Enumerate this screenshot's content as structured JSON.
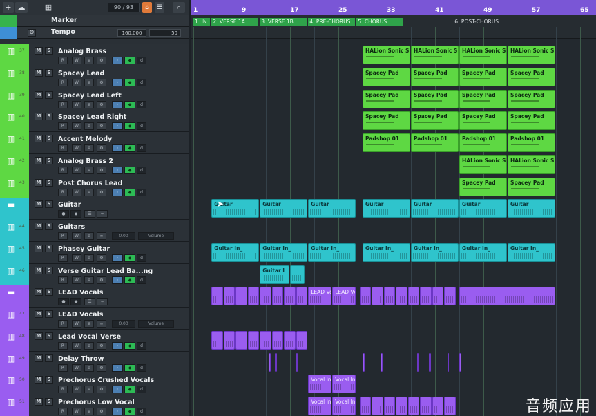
{
  "toolbar": {
    "add_label": "+",
    "counter": "90 / 93"
  },
  "ruler_rows": {
    "marker_label": "Marker",
    "tempo_label": "Tempo",
    "tempo_value": "160.000",
    "tempo_value2": "50"
  },
  "ruler": {
    "bars": [
      "1",
      "9",
      "17",
      "25",
      "33",
      "41",
      "49",
      "57",
      "65"
    ]
  },
  "markers": [
    {
      "label": "1: IN"
    },
    {
      "label": "2: VERSE 1A"
    },
    {
      "label": "3: VERSE 1B"
    },
    {
      "label": "4: PRE-CHORUS"
    },
    {
      "label": "5: CHORUS"
    },
    {
      "label": "6: POST-CHORUS"
    }
  ],
  "tracks": [
    {
      "num": "37",
      "name": "Analog Brass",
      "color": "#5ed843"
    },
    {
      "num": "38",
      "name": "Spacey Lead",
      "color": "#5ed843"
    },
    {
      "num": "39",
      "name": "Spacey Lead Left",
      "color": "#5ed843"
    },
    {
      "num": "40",
      "name": "Spacey Lead Right",
      "color": "#5ed843"
    },
    {
      "num": "41",
      "name": "Accent Melody",
      "color": "#5ed843"
    },
    {
      "num": "42",
      "name": "Analog Brass 2",
      "color": "#5ed843"
    },
    {
      "num": "43",
      "name": "Post Chorus Lead",
      "color": "#5ed843"
    },
    {
      "num": "",
      "name": "Guitar",
      "color": "#2fc4cc"
    },
    {
      "num": "44",
      "name": "Guitars",
      "color": "#2fc4cc",
      "vol": "0.00",
      "vol_label": "Volume"
    },
    {
      "num": "45",
      "name": "Phasey Guitar",
      "color": "#2fc4cc"
    },
    {
      "num": "46",
      "name": "Verse Guitar Lead Ba...ng",
      "color": "#2fc4cc"
    },
    {
      "num": "",
      "name": "LEAD Vocals",
      "color": "#9a5df0"
    },
    {
      "num": "47",
      "name": "LEAD Vocals",
      "color": "#9a5df0",
      "vol": "0.00",
      "vol_label": "Volume"
    },
    {
      "num": "48",
      "name": "Lead Vocal Verse",
      "color": "#9a5df0"
    },
    {
      "num": "49",
      "name": "Delay Throw",
      "color": "#9a5df0"
    },
    {
      "num": "50",
      "name": "Prechorus Crushed Vocals",
      "color": "#9a5df0"
    },
    {
      "num": "51",
      "name": "Prechorus Low Vocal",
      "color": "#9a5df0"
    }
  ],
  "clips": {
    "halion": "HALion Sonic SE",
    "spacey_pad": "Spacey Pad",
    "padshop": "Padshop 01",
    "guitar": "Guitar",
    "guitar_in": "Guitar In_",
    "guitar_i": "Guitar I",
    "lead_vo": "LEAD Vo",
    "lead_vc": "LEAD Vc",
    "vocal_in": "Vocal In"
  },
  "colors": {
    "green": "#5ed843",
    "teal": "#2fc4cc",
    "purple": "#9a5df0",
    "ruler": "#7a56d6"
  },
  "watermark": "音频应用"
}
